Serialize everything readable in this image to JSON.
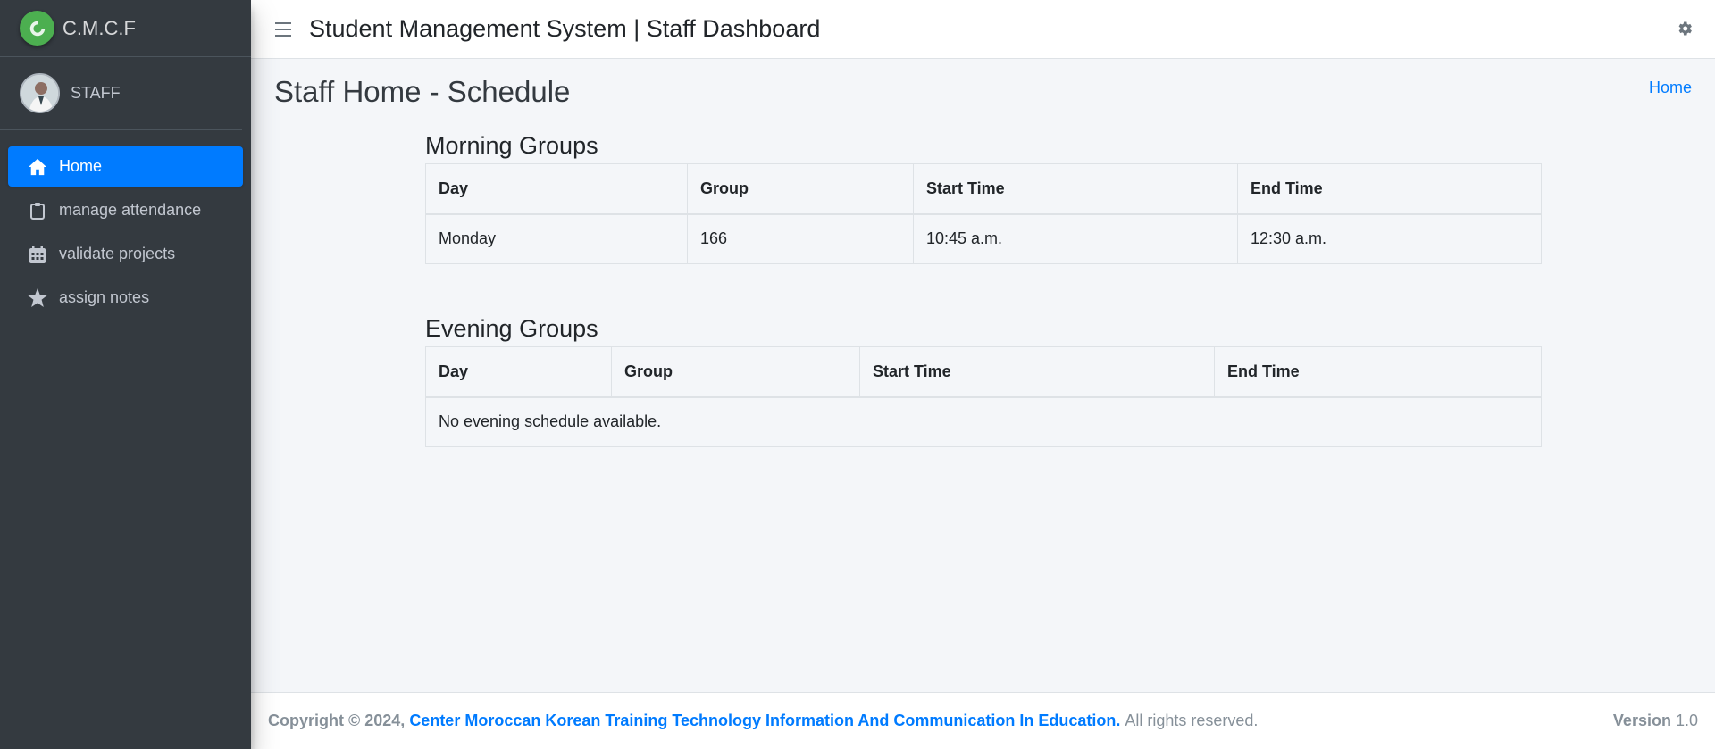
{
  "brand": {
    "name": "C.M.C.F",
    "logo_icon": "brand-logo-icon",
    "logo_color": "#4caf50"
  },
  "user": {
    "name": "STAFF"
  },
  "sidebar": {
    "items": [
      {
        "label": "Home",
        "icon": "home-icon",
        "active": true
      },
      {
        "label": "manage attendance",
        "icon": "clipboard-icon",
        "active": false
      },
      {
        "label": "validate projects",
        "icon": "calendar-icon",
        "active": false
      },
      {
        "label": "assign notes",
        "icon": "star-icon",
        "active": false
      }
    ]
  },
  "topbar": {
    "title": "Student Management System | Staff Dashboard",
    "settings_icon": "gear-icon"
  },
  "page": {
    "title": "Staff Home - Schedule",
    "breadcrumb": "Home"
  },
  "morning": {
    "heading": "Morning Groups",
    "columns": [
      "Day",
      "Group",
      "Start Time",
      "End Time"
    ],
    "rows": [
      [
        "Monday",
        "166",
        "10:45 a.m.",
        "12:30 a.m."
      ]
    ]
  },
  "evening": {
    "heading": "Evening Groups",
    "columns": [
      "Day",
      "Group",
      "Start Time",
      "End Time"
    ],
    "empty_message": "No evening schedule available."
  },
  "footer": {
    "copyright": "Copyright © 2024,",
    "org": "Center Moroccan Korean Training Technology Information And Communication In Education.",
    "rights": "All rights reserved.",
    "version_label": "Version",
    "version_value": "1.0"
  },
  "colors": {
    "sidebar_bg": "#343a40",
    "accent": "#007bff",
    "content_bg": "#f4f6f9"
  }
}
